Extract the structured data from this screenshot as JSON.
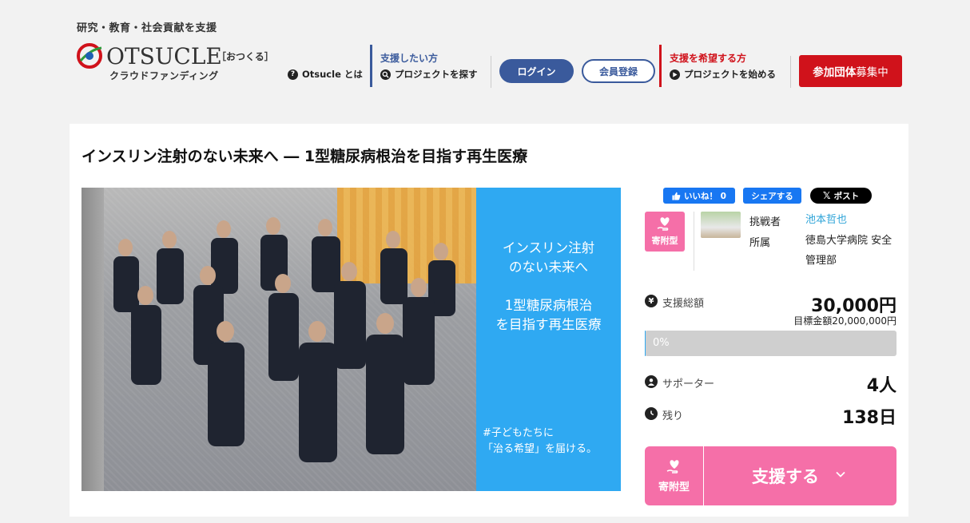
{
  "header": {
    "tagline": "研究・教育・社会貢献を支援",
    "logo_text": "OTSUCLE",
    "logo_kana": "［おつくる］",
    "logo_sub": "クラウドファンディング",
    "about_label": "Otsucle とは",
    "supporter_label": "支援したい方",
    "find_project_label": "プロジェクトを探す",
    "login_label": "ログイン",
    "register_label": "会員登録",
    "requester_label": "支援を希望する方",
    "start_project_label": "プロジェクトを始める",
    "join_label_bold": "参加団体",
    "join_label_normal": "募集中",
    "colors": {
      "blue": "#3a5a9c",
      "red": "#d0121b"
    }
  },
  "project": {
    "title": "インスリン注射のない未来へ ― 1型糖尿病根治を目指す再生医療",
    "hero_lines": [
      "インスリン注射",
      "のない未来へ",
      "1型糖尿病根治",
      "を目指す再生医療"
    ],
    "hero_tag_lines": [
      "#子どもたちに",
      "「治る希望」を届ける。"
    ],
    "hero_color": "#2fa9f2"
  },
  "share": {
    "fb_like_label": "いいね！ 0",
    "fb_share_label": "シェアする",
    "x_post_label": "ポスト"
  },
  "info": {
    "type_badge": "寄附型",
    "challenger_label": "挑戦者",
    "challenger_name": "池本哲也",
    "affiliation_label": "所属",
    "affiliation_value": "徳島大学病院 安全管理部"
  },
  "stats": {
    "total_label": "支援総額",
    "total_value": "30,000円",
    "goal_text": "目標金額20,000,000円",
    "progress_text": "0%",
    "progress_fraction": 0.0015,
    "supporters_label": "サポーター",
    "supporters_value": "4人",
    "remaining_label": "残り",
    "remaining_value": "138日"
  },
  "support_button": {
    "type_label": "寄附型",
    "label": "支援する",
    "color": "#f56fa8"
  }
}
